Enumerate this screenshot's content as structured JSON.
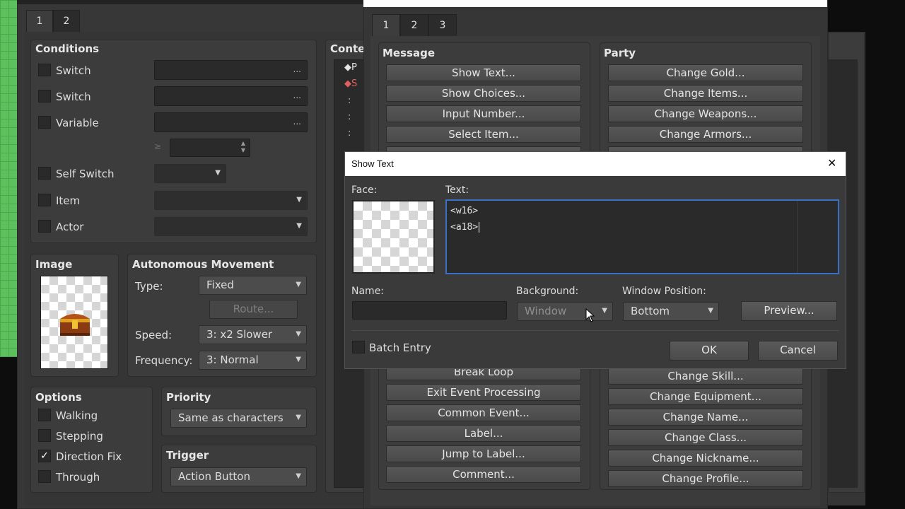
{
  "left": {
    "tabs": [
      "1",
      "2"
    ],
    "conditions": {
      "title": "Conditions",
      "rows": [
        "Switch",
        "Switch",
        "Variable",
        "Self Switch",
        "Item",
        "Actor"
      ],
      "dots": "...",
      "ge": "≥"
    },
    "image": {
      "title": "Image"
    },
    "movement": {
      "title": "Autonomous Movement",
      "type_label": "Type:",
      "type_value": "Fixed",
      "route_label": "Route...",
      "speed_label": "Speed:",
      "speed_value": "3: x2 Slower",
      "freq_label": "Frequency:",
      "freq_value": "3: Normal"
    },
    "options": {
      "title": "Options",
      "items": [
        {
          "label": "Walking",
          "checked": false
        },
        {
          "label": "Stepping",
          "checked": false
        },
        {
          "label": "Direction Fix",
          "checked": true
        },
        {
          "label": "Through",
          "checked": false
        }
      ]
    },
    "priority": {
      "title": "Priority",
      "value": "Same as characters"
    },
    "trigger": {
      "title": "Trigger",
      "value": "Action Button"
    },
    "contents": {
      "title": "Conte",
      "line1": "◆P",
      "line2": "◆S",
      "colon": ":"
    }
  },
  "commands": {
    "tabs": [
      "1",
      "2",
      "3"
    ],
    "message": {
      "title": "Message",
      "top": [
        "Show Text...",
        "Show Choices...",
        "Input Number...",
        "Select Item..."
      ],
      "bottom": [
        "Break Loop",
        "Exit Event Processing",
        "Common Event...",
        "Label...",
        "Jump to Label...",
        "Comment..."
      ]
    },
    "party": {
      "title": "Party",
      "top": [
        "Change Gold...",
        "Change Items...",
        "Change Weapons...",
        "Change Armors..."
      ],
      "bottom": [
        "Change Skill...",
        "Change Equipment...",
        "Change Name...",
        "Change Class...",
        "Change Nickname...",
        "Change Profile..."
      ]
    }
  },
  "dialog": {
    "title": "Show Text",
    "close": "✕",
    "face_label": "Face:",
    "text_label": "Text:",
    "text_lines": [
      "<w16>",
      "<a18>"
    ],
    "name_label": "Name:",
    "name_value": "",
    "background_label": "Background:",
    "background_value": "Window",
    "position_label": "Window Position:",
    "position_value": "Bottom",
    "preview": "Preview...",
    "batch": "Batch Entry",
    "ok": "OK",
    "cancel": "Cancel"
  },
  "colors": {
    "accent": "#3a6fc4",
    "panel": "#3c3c3c",
    "checkmark": "#ffffff"
  }
}
